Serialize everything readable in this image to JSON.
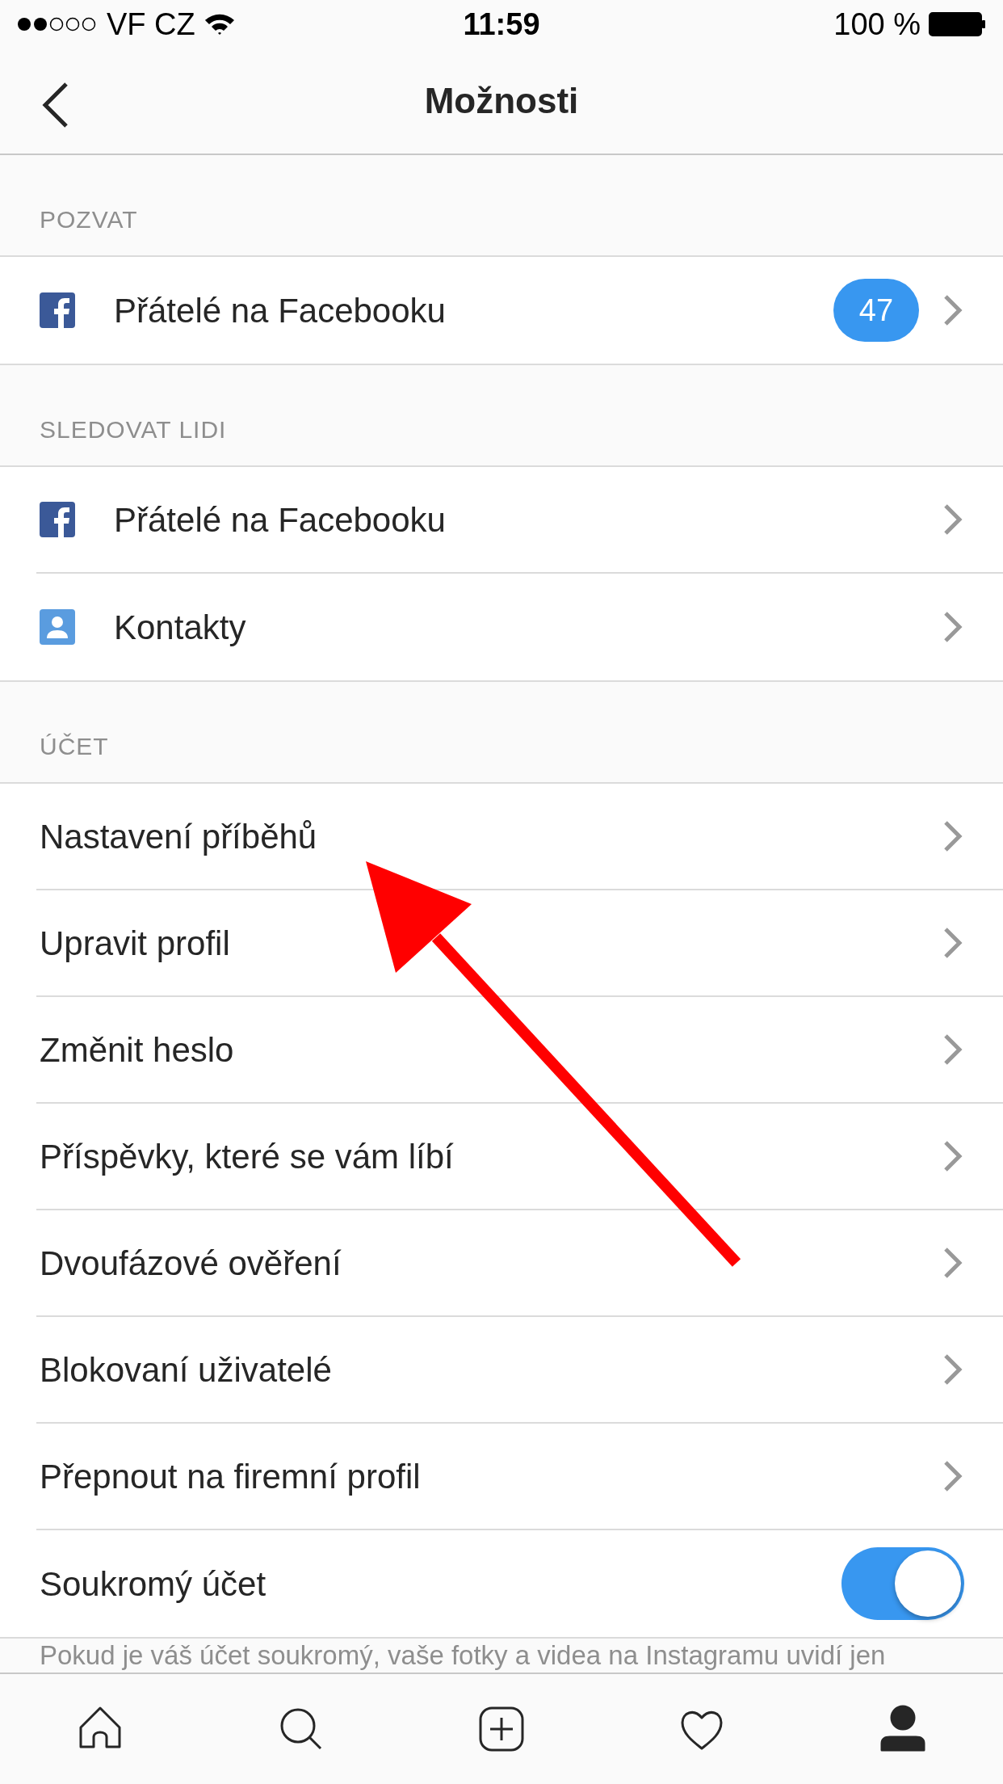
{
  "status_bar": {
    "carrier": "VF CZ",
    "time": "11:59",
    "battery": "100 %"
  },
  "nav": {
    "title": "Možnosti"
  },
  "sections": [
    {
      "header": "POZVAT",
      "rows": [
        {
          "kind": "facebook",
          "label": "Přátelé na Facebooku",
          "badge": "47"
        }
      ]
    },
    {
      "header": "SLEDOVAT LIDI",
      "rows": [
        {
          "kind": "facebook",
          "label": "Přátelé na Facebooku"
        },
        {
          "kind": "contacts",
          "label": "Kontakty"
        }
      ]
    },
    {
      "header": "ÚČET",
      "rows": [
        {
          "kind": "plain",
          "label": "Nastavení příběhů"
        },
        {
          "kind": "plain",
          "label": "Upravit profil"
        },
        {
          "kind": "plain",
          "label": "Změnit heslo"
        },
        {
          "kind": "plain",
          "label": "Příspěvky, které se vám líbí"
        },
        {
          "kind": "plain",
          "label": "Dvoufázové ověření"
        },
        {
          "kind": "plain",
          "label": "Blokovaní uživatelé"
        },
        {
          "kind": "plain",
          "label": "Přepnout na firemní profil"
        },
        {
          "kind": "toggle",
          "label": "Soukromý účet",
          "on": true
        }
      ]
    }
  ],
  "footnote": "Pokud je váš účet soukromý, vaše fotky a videa na Instagramu uvidí jen",
  "tabs": [
    {
      "kind": "home",
      "selected": false
    },
    {
      "kind": "search",
      "selected": false
    },
    {
      "kind": "add",
      "selected": false
    },
    {
      "kind": "activity",
      "selected": false
    },
    {
      "kind": "profile",
      "selected": true
    }
  ],
  "overlay": {
    "kind": "arrow"
  }
}
